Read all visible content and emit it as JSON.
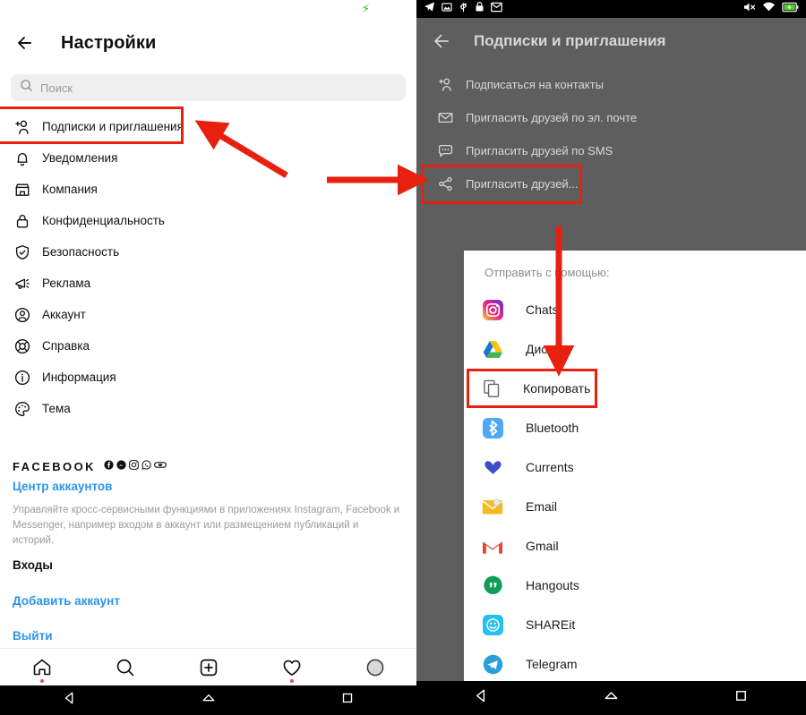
{
  "left_phone": {
    "status_bar": {
      "charging_icon": "charging-bolt-icon"
    },
    "app_bar": {
      "back_icon": "back-arrow-icon",
      "title": "Настройки"
    },
    "search": {
      "icon": "search-icon",
      "placeholder": "Поиск"
    },
    "settings_items": [
      {
        "icon": "person-add-icon",
        "label": "Подписки и приглашения",
        "highlighted": true
      },
      {
        "icon": "bell-icon",
        "label": "Уведомления"
      },
      {
        "icon": "store-icon",
        "label": "Компания"
      },
      {
        "icon": "lock-icon",
        "label": "Конфиденциальность"
      },
      {
        "icon": "shield-check-icon",
        "label": "Безопасность"
      },
      {
        "icon": "megaphone-icon",
        "label": "Реклама"
      },
      {
        "icon": "account-circle-icon",
        "label": "Аккаунт"
      },
      {
        "icon": "lifebuoy-icon",
        "label": "Справка"
      },
      {
        "icon": "info-icon",
        "label": "Информация"
      },
      {
        "icon": "palette-icon",
        "label": "Тема"
      }
    ],
    "facebook_section": {
      "heading": "FACEBOOK",
      "brand_icons": [
        "facebook-icon",
        "messenger-icon",
        "instagram-icon",
        "whatsapp-icon",
        "portal-icon"
      ],
      "accounts_center_link": "Центр аккаунтов",
      "description": "Управляйте кросс-сервисными функциями в приложениях Instagram, Facebook и Messenger, например входом в аккаунт или размещением публикаций и историй."
    },
    "logins_section": {
      "heading": "Входы",
      "add_account_link": "Добавить аккаунт",
      "logout_link": "Выйти"
    },
    "tab_bar": [
      {
        "icon": "home-icon",
        "badge": true
      },
      {
        "icon": "search-icon",
        "badge": false
      },
      {
        "icon": "add-box-icon",
        "badge": false
      },
      {
        "icon": "heart-icon",
        "badge": true
      },
      {
        "icon": "avatar-icon",
        "badge": false
      }
    ],
    "nav_bar": [
      {
        "icon": "android-back-icon"
      },
      {
        "icon": "android-home-icon"
      },
      {
        "icon": "android-recents-icon"
      }
    ]
  },
  "right_phone": {
    "status_bar": {
      "left_icons": [
        "telegram-icon",
        "screenshot-icon",
        "usb-icon",
        "lock-icon",
        "mail-icon"
      ],
      "right_icons": [
        "mute-icon",
        "wifi-icon",
        "battery-charging-icon"
      ]
    },
    "app_bar": {
      "back_icon": "back-arrow-icon",
      "title": "Подписки и приглашения"
    },
    "menu_items": [
      {
        "icon": "person-add-icon",
        "label": "Подписаться на контакты"
      },
      {
        "icon": "envelope-icon",
        "label": "Пригласить друзей по эл. почте"
      },
      {
        "icon": "sms-bubble-icon",
        "label": "Пригласить друзей по SMS"
      },
      {
        "icon": "share-icon",
        "label": "Пригласить друзей...",
        "highlighted": true
      }
    ],
    "share_sheet": {
      "title": "Отправить с помощью:",
      "items": [
        {
          "icon": "instagram-icon",
          "label": "Chats"
        },
        {
          "icon": "google-drive-icon",
          "label": "Диск"
        },
        {
          "icon": "copy-icon",
          "label": "Копировать",
          "highlighted": true
        },
        {
          "icon": "bluetooth-icon",
          "label": "Bluetooth"
        },
        {
          "icon": "currents-icon",
          "label": "Currents"
        },
        {
          "icon": "email-icon",
          "label": "Email"
        },
        {
          "icon": "gmail-icon",
          "label": "Gmail"
        },
        {
          "icon": "hangouts-icon",
          "label": "Hangouts"
        },
        {
          "icon": "shareit-icon",
          "label": "SHAREit"
        },
        {
          "icon": "telegram-icon",
          "label": "Telegram"
        }
      ]
    },
    "nav_bar": [
      {
        "icon": "android-back-icon"
      },
      {
        "icon": "android-home-icon"
      },
      {
        "icon": "android-recents-icon"
      }
    ]
  },
  "annotations": {
    "accent_color": "#e82010",
    "arrows": [
      {
        "name": "arrow-to-subscriptions",
        "direction": "up-left"
      },
      {
        "name": "arrow-to-invite-friends",
        "direction": "right"
      },
      {
        "name": "arrow-to-copy",
        "direction": "down"
      }
    ],
    "highlight_boxes": [
      {
        "name": "highlight-subscriptions-row"
      },
      {
        "name": "highlight-invite-friends-row"
      },
      {
        "name": "highlight-copy-row"
      }
    ]
  }
}
